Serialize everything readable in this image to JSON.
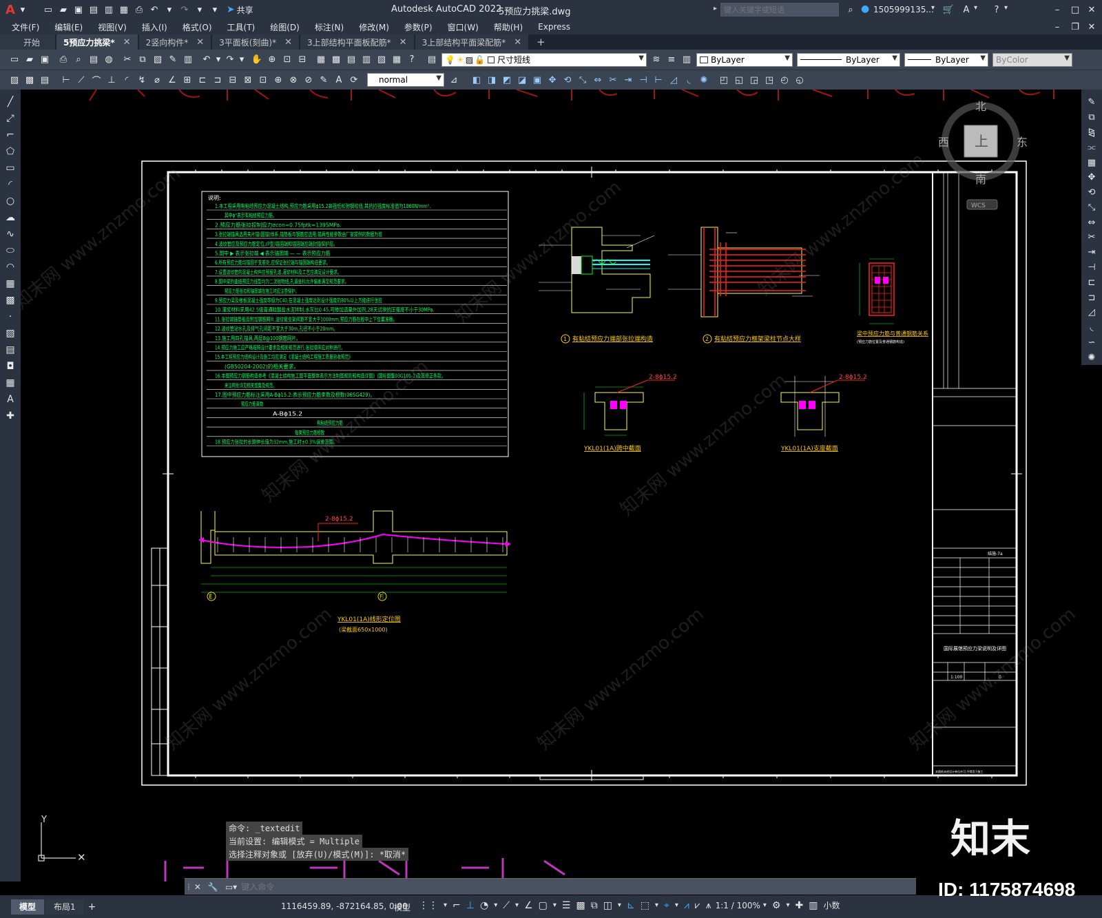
{
  "titlebar": {
    "app_title": "Autodesk AutoCAD 2022",
    "file_name": "5预应力挑梁.dwg",
    "share_label": "共享",
    "search_placeholder": "键入关键字或短语",
    "user_name": "1505999135...",
    "app_letter": "A"
  },
  "menu": [
    "文件(F)",
    "编辑(E)",
    "视图(V)",
    "插入(I)",
    "格式(O)",
    "工具(T)",
    "绘图(D)",
    "标注(N)",
    "修改(M)",
    "参数(P)",
    "窗口(W)",
    "帮助(H)",
    "Express"
  ],
  "tabs": [
    {
      "label": "开始",
      "active": false,
      "closable": false
    },
    {
      "label": "5预应力挑梁*",
      "active": true,
      "closable": true
    },
    {
      "label": "2竖向构件*",
      "active": false,
      "closable": true
    },
    {
      "label": "3平面板(刻曲)*",
      "active": false,
      "closable": true
    },
    {
      "label": "3上部结构平面板配筋*",
      "active": false,
      "closable": true
    },
    {
      "label": "3上部结构平面梁配筋*",
      "active": false,
      "closable": true
    }
  ],
  "add_tab_label": "+",
  "toolbar": {
    "layer_name": "尺寸短线",
    "color": "ByLayer",
    "linetype": "ByLayer",
    "lineweight": "ByLayer",
    "plotstyle": "ByColor",
    "text_style": "normal"
  },
  "viewcube": {
    "north": "北",
    "south": "南",
    "east": "东",
    "west": "西",
    "top": "上",
    "wcs": "WCS"
  },
  "drawing": {
    "notes_title": "说明:",
    "notes": [
      "1.本工程采用有粘结预应力混凝土结构,预应力筋采用ϕ15.2高强低松弛钢绞线,其抗拉强度标准值为1860N/mm².",
      "其中ϕ°表示有粘结预应力筋。",
      "2.预应力筋张拉控制应力σcon=0.75fptk=1395MPa.",
      "3.张拉端锚具选用夹片锚(圆锚)体系,锚垫板与钢筋应选用,锚具性能参数由厂家提供的数据为准",
      "4.波纹管应及预应力筋定位,(P型)锚固端和锚固端后端封锚保护层。",
      "5.图中 ▶ 表示张拉端 ◀ 表示锚固端 — — 表示预应力筋",
      "6.所有预应力筋均锚固于支座处,应保证张拉端与锚固端构造要求。",
      "7.设置波纹管的混凝土构件应预留孔道,灌浆材料及工艺应满足设计要求。",
      "8.图中梁的曲线预应力线型均为二次抛物线,孔道坐标允许偏差满足规范要求。",
      "预应力筋张拉和锚固端在施工时应注意保护。",
      "9.预应力梁及楼板混凝土强度等级为C40,在混凝土强度达到设计强度的80%以上方能进行张拉",
      "10.灌浆材料采用42.5级普通硅酸盐水泥拌制,水灰比0.45,可掺加适量外加剂,28天试块抗压强度不小于30MPa.",
      "11.张拉端锚垫板后附加钢筋网片,波纹管支架间距不宜大于1000mm,预应力筋在板中上下位置准确。",
      "12.波纹管泌水孔及排气孔间距不宜大于30m,孔径不小于20mm。",
      "13.施工用四孔锚具,两层8@100钢筋网片。",
      "14.预应力施工应严格按照设计要求及相关规范进行,张拉顺序应对称进行。",
      "15.本工程预应力结构设计及施工均应满足《混凝土结构工程施工质量验收规范》",
      "(GB50204-2002)的相关要求。",
      "16.本图预应力钢筋构造参考《混凝土结构施工图平面整体表示方法制图规则和构造详图》(国标图集03G101-1)及其修正条款。",
      "未注明处详见相关图集及规范。",
      "17.图中预应力筋标注采用A-Bϕ15.2:表示预应力筋束数及根数(06SG429)。",
      "预应力筋束数",
      "A-Bϕ15.2",
      "有粘结预应力筋",
      "每束预应力筋根数",
      "18.预应力张拉的长期伸长值为32mm,施工时±0.3%误差范围。"
    ],
    "detail1_caption": "有粘结预应力端部张拉端构造",
    "detail1_num": "1",
    "detail2_caption": "有粘结预应力框架梁柱节点大样",
    "detail2_num": "2",
    "detail3_caption": "梁中预应力筋与普通钢筋关系",
    "detail3_note": "(预应力筋位置及普通钢筋构造)",
    "section1_label": "2-8ϕ15.2",
    "section1_caption": "YKL01(1A)跨中截面",
    "section2_label": "2-8ϕ15.2",
    "section2_caption": "YKL01(1A)支座截面",
    "elev_label": "2-8ϕ15.2",
    "elev_caption": "YKL01(1A)线形定位图",
    "elev_subcaption": "(梁截面650x1000)",
    "axis_e": "E",
    "axis_f": "F",
    "title_block": {
      "project_title": "国际展馆预应力梁说明及详图",
      "drawing_no": "结施-7a",
      "scale": "1:100",
      "sheet": "0",
      "footer": "本图纸未经设计单位许可,不得用于施工"
    },
    "watermark": "知末网 www.znzmo.com"
  },
  "command": {
    "history": [
      "命令: _textedit",
      "当前设置: 编辑模式 = Multiple",
      "选择注释对象或 [放弃(U)/模式(M)]: *取消*"
    ],
    "input_placeholder": "键入命令"
  },
  "layout_tabs": [
    {
      "label": "模型",
      "active": true
    },
    {
      "label": "布局1",
      "active": false
    }
  ],
  "status": {
    "coords": "1116459.89, -872164.85, 0.00",
    "model_label": "模型",
    "scale": "1:1 / 100%",
    "units": "小数"
  },
  "brand": {
    "logo_text": "知末",
    "id_text": "ID: 1175874698"
  },
  "colors": {
    "canvas": "#000000",
    "ui_dark": "#2b3340",
    "ui_mid": "#3b4453",
    "cad_white": "#ffffff",
    "cad_yellow": "#ffff00",
    "cad_red": "#ff2020",
    "cad_green": "#00ff00",
    "cad_cyan": "#00ffff",
    "cad_magenta": "#ff00ff",
    "accent_blue": "#3fa9f5"
  }
}
